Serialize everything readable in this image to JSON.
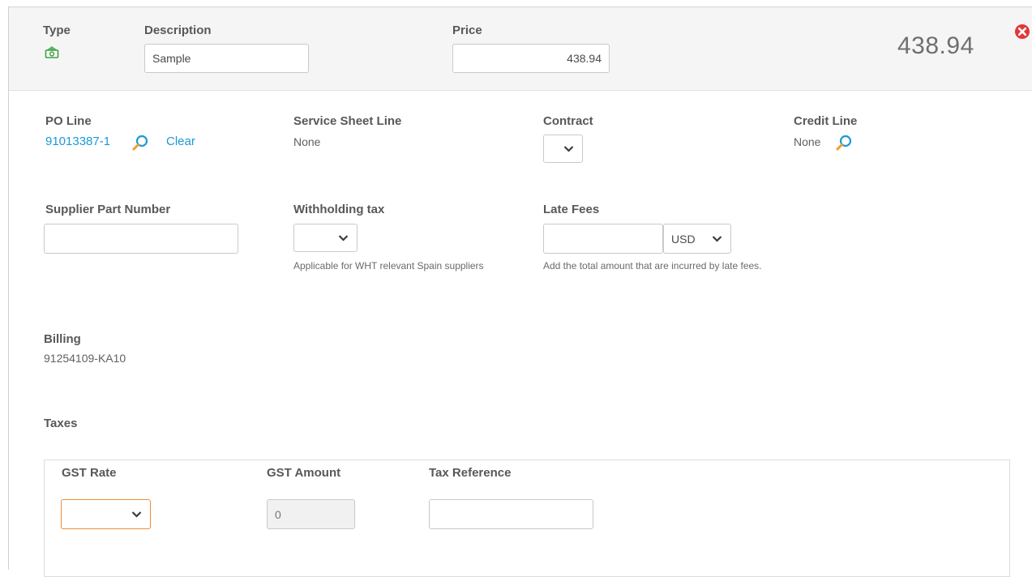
{
  "header": {
    "type_label": "Type",
    "description_label": "Description",
    "description_value": "Sample",
    "price_label": "Price",
    "price_value": "438.94",
    "total_amount": "438.94",
    "type_icon": "money-icon",
    "remove_icon": "remove-circle-icon",
    "accent_color": "#e4353b",
    "icon_color": "#4caf50"
  },
  "po_line": {
    "label": "PO Line",
    "value": "91013387-1",
    "search_icon": "search-icon",
    "clear_label": "Clear"
  },
  "service_sheet_line": {
    "label": "Service Sheet Line",
    "value": "None"
  },
  "contract": {
    "label": "Contract",
    "selected": ""
  },
  "credit_line": {
    "label": "Credit Line",
    "value": "None",
    "search_icon": "search-icon"
  },
  "supplier_part_number": {
    "label": "Supplier Part Number",
    "value": ""
  },
  "withholding_tax": {
    "label": "Withholding tax",
    "selected": "",
    "help": "Applicable for WHT relevant Spain suppliers"
  },
  "late_fees": {
    "label": "Late Fees",
    "value": "",
    "currency": "USD",
    "help": "Add the total amount that are incurred by late fees."
  },
  "billing": {
    "label": "Billing",
    "value": "91254109-KA10"
  },
  "taxes": {
    "label": "Taxes",
    "gst_rate_label": "GST Rate",
    "gst_rate_selected": "",
    "gst_amount_label": "GST Amount",
    "gst_amount_value": "0",
    "tax_reference_label": "Tax Reference",
    "tax_reference_value": ""
  }
}
